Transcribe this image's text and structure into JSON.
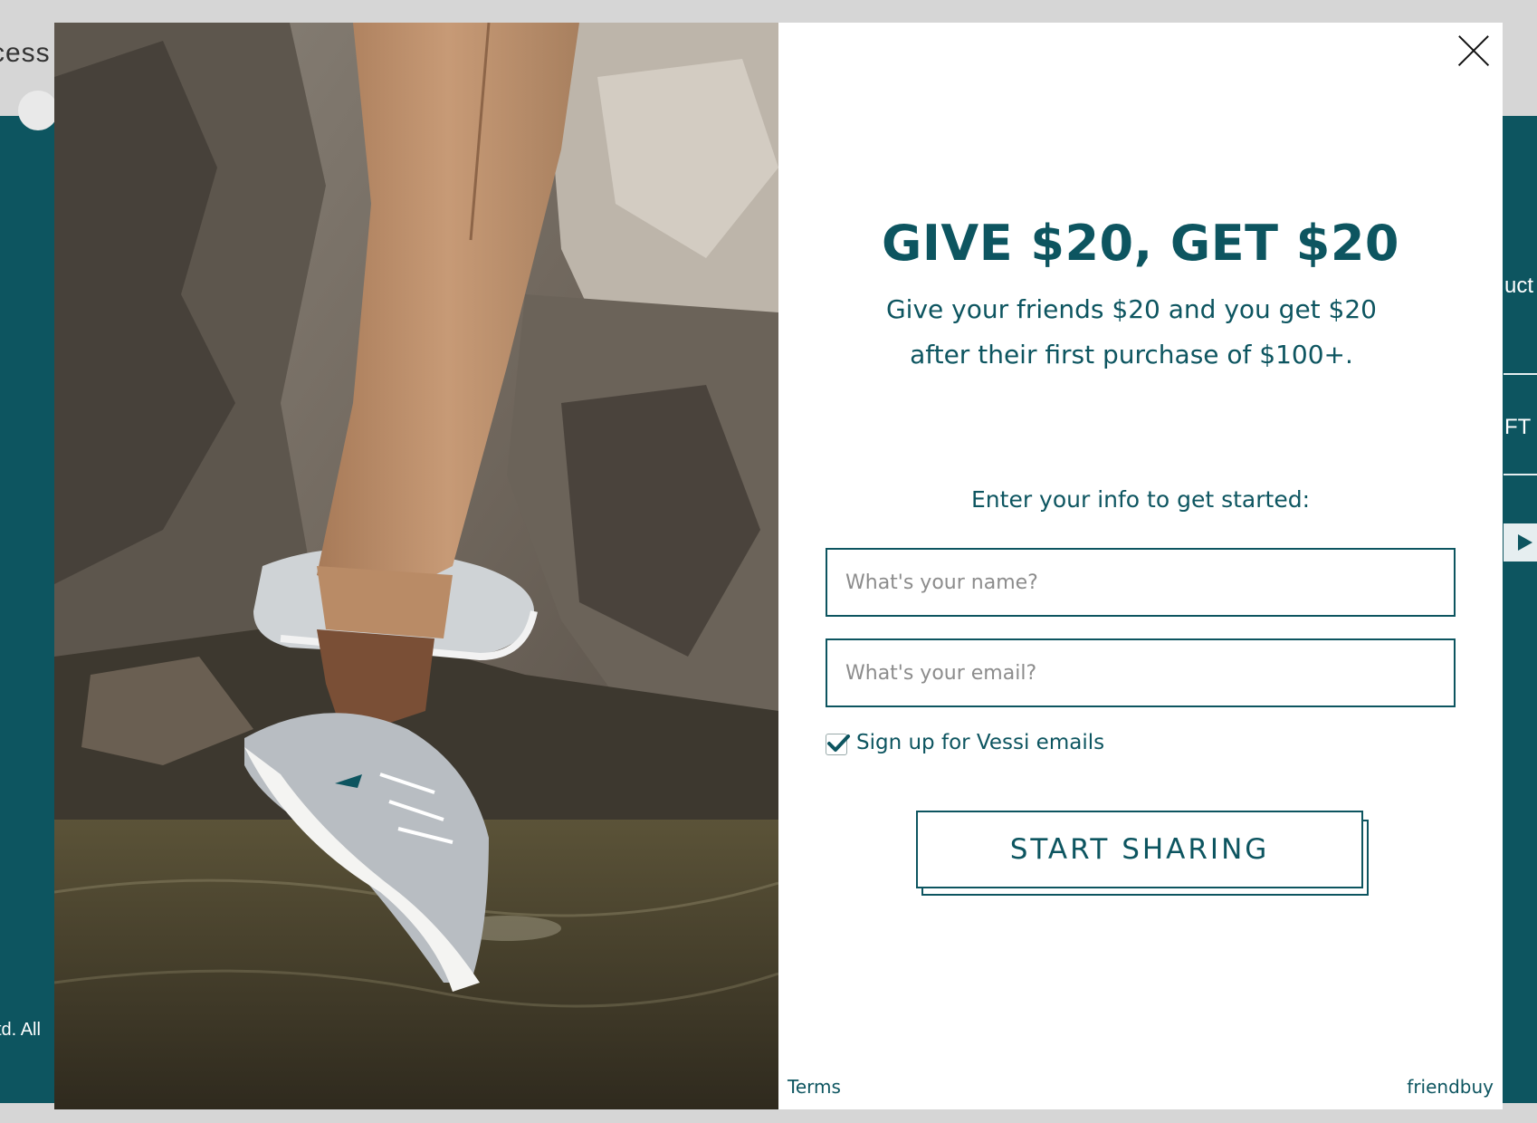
{
  "background_page": {
    "top_text": "cess",
    "footer_text": "td. All",
    "right_text_1": "uct",
    "right_text_2": "FT"
  },
  "modal": {
    "close_icon": "close-icon",
    "headline": "GIVE $20, GET $20",
    "subhead": "Give your friends $20 and you get $20 after their first purchase of $100+.",
    "prompt": "Enter your info to get started:",
    "name_field": {
      "placeholder": "What's your name?",
      "value": ""
    },
    "email_field": {
      "placeholder": "What's your email?",
      "value": ""
    },
    "optin": {
      "label": "Sign up for Vessi emails",
      "checked": true
    },
    "cta_label": "START SHARING",
    "footer": {
      "terms": "Terms",
      "powered_by": "friendbuy"
    }
  },
  "colors": {
    "brand_teal": "#0d5560",
    "background_gray": "#d6d6d6",
    "white": "#ffffff"
  }
}
